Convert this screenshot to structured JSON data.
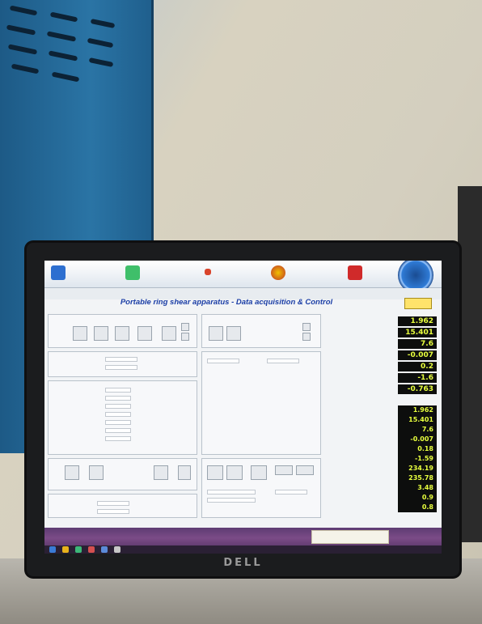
{
  "app": {
    "title": "Portable ring shear apparatus - Data acquisition & Control"
  },
  "monitor": {
    "brand": "DELL"
  },
  "readouts": {
    "group1": [
      "1.962",
      "15.401",
      "7.6",
      "-0.007",
      "0.2",
      "-1.6",
      "-0.763"
    ],
    "group2": [
      "1.962",
      "15.401",
      "7.6",
      "-0.007",
      "0.18",
      "-1.59",
      "234.19",
      "235.78",
      "3.48",
      "0.9",
      "0.8"
    ]
  },
  "colors": {
    "readout_bg": "#0d0e0d",
    "readout_text": "#e8ff3e",
    "title_color": "#1b3ea6",
    "cabinet_blue": "#2a74a5"
  },
  "icons": [
    "shortcut-icon",
    "folder-icon",
    "app-icon",
    "record-icon",
    "gauge-icon"
  ]
}
